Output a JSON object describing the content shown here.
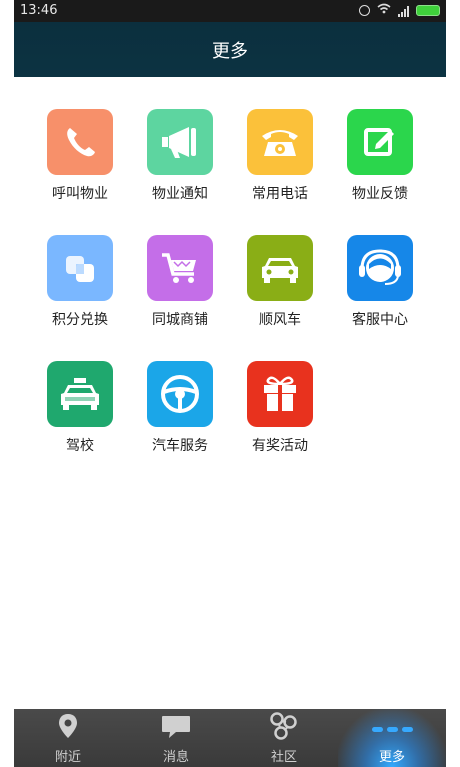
{
  "status": {
    "time": "13:46"
  },
  "header": {
    "title": "更多"
  },
  "tiles": [
    {
      "label": "呼叫物业",
      "icon": "phone-icon",
      "color": "#f7906a"
    },
    {
      "label": "物业通知",
      "icon": "megaphone-icon",
      "color": "#5dd5a0"
    },
    {
      "label": "常用电话",
      "icon": "telephone-icon",
      "color": "#fbc13a"
    },
    {
      "label": "物业反馈",
      "icon": "edit-icon",
      "color": "#2bd64c"
    },
    {
      "label": "积分兑换",
      "icon": "exchange-icon",
      "color": "#7ab7ff"
    },
    {
      "label": "同城商铺",
      "icon": "cart-icon",
      "color": "#c46ee8"
    },
    {
      "label": "顺风车",
      "icon": "car-icon",
      "color": "#8aae16"
    },
    {
      "label": "客服中心",
      "icon": "headset-icon",
      "color": "#1687e8"
    },
    {
      "label": "驾校",
      "icon": "taxi-icon",
      "color": "#1fa86e"
    },
    {
      "label": "汽车服务",
      "icon": "steering-wheel-icon",
      "color": "#1ba6e8"
    },
    {
      "label": "有奖活动",
      "icon": "gift-icon",
      "color": "#e8321e"
    }
  ],
  "nav": [
    {
      "label": "附近",
      "icon": "location-pin-icon"
    },
    {
      "label": "消息",
      "icon": "message-icon"
    },
    {
      "label": "社区",
      "icon": "community-icon"
    },
    {
      "label": "更多",
      "icon": "more-dots-icon",
      "active": true
    }
  ]
}
